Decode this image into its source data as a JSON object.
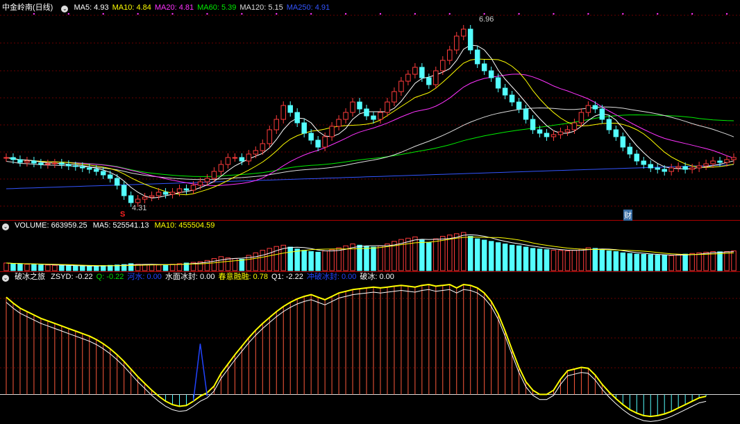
{
  "main": {
    "title": "中金岭南(日线)",
    "ma": [
      {
        "label": "MA5: 4.93",
        "color": "#ffffff"
      },
      {
        "label": "MA10: 4.84",
        "color": "#ffff00"
      },
      {
        "label": "MA20: 4.81",
        "color": "#ff33ff"
      },
      {
        "label": "MA60: 5.39",
        "color": "#00ee00"
      },
      {
        "label": "MA120: 5.15",
        "color": "#dddddd"
      },
      {
        "label": "MA250: 4.91",
        "color": "#3355ff"
      }
    ],
    "high_label": "6.96",
    "low_label": "4.31",
    "s_marker": "S",
    "cai_marker": "财"
  },
  "volume": {
    "label": "VOLUME: 663959.25",
    "ma5": "MA5: 525541.13",
    "ma10": "MA10: 455504.59"
  },
  "indicator": {
    "name": "破冰之旅",
    "items": [
      {
        "label": "ZSYD: -0.22",
        "color": "#ffffff"
      },
      {
        "label": "Q: -0.22",
        "color": "#00dd00"
      },
      {
        "label": "河水: 0.00",
        "color": "#2244ff"
      },
      {
        "label": "水面冰封: 0.00",
        "color": "#ffffff"
      },
      {
        "label": "春意融融: 0.78",
        "color": "#ffff00"
      },
      {
        "label": "Q1: -2.22",
        "color": "#ffffff"
      },
      {
        "label": "冲破冰封: 0.00",
        "color": "#2244ff"
      },
      {
        "label": "破冰: 0.00",
        "color": "#ffffff"
      }
    ]
  },
  "chart_data": [
    {
      "type": "candlestick",
      "title": "中金岭南(日线)",
      "ylim": [
        4.2,
        7.1
      ],
      "high": 6.96,
      "low": 4.31,
      "close": [
        5.05,
        5.02,
        4.98,
        5.0,
        4.97,
        4.95,
        4.96,
        4.97,
        4.95,
        4.93,
        4.92,
        4.9,
        4.88,
        4.85,
        4.8,
        4.75,
        4.65,
        4.5,
        4.4,
        4.45,
        4.48,
        4.5,
        4.55,
        4.52,
        4.55,
        4.6,
        4.58,
        4.65,
        4.7,
        4.75,
        4.85,
        4.95,
        5.05,
        5.05,
        5.0,
        5.1,
        5.15,
        5.25,
        5.45,
        5.6,
        5.8,
        5.7,
        5.55,
        5.4,
        5.3,
        5.2,
        5.35,
        5.5,
        5.6,
        5.7,
        5.85,
        5.75,
        5.65,
        5.6,
        5.7,
        5.85,
        6.0,
        6.15,
        6.25,
        6.35,
        6.2,
        6.1,
        6.3,
        6.45,
        6.6,
        6.8,
        6.9,
        6.6,
        6.4,
        6.3,
        6.2,
        6.05,
        5.95,
        5.85,
        5.75,
        5.6,
        5.45,
        5.4,
        5.35,
        5.38,
        5.42,
        5.45,
        5.55,
        5.7,
        5.8,
        5.75,
        5.6,
        5.45,
        5.35,
        5.2,
        5.1,
        5.0,
        4.95,
        4.9,
        4.88,
        4.85,
        4.9,
        4.92,
        4.88,
        4.9,
        4.93,
        4.96,
        5.0,
        4.98,
        5.02,
        5.05
      ]
    },
    {
      "type": "bar",
      "title": "VOLUME",
      "values": [
        60,
        55,
        52,
        50,
        48,
        45,
        44,
        42,
        40,
        38,
        37,
        35,
        36,
        38,
        40,
        42,
        45,
        48,
        55,
        50,
        48,
        46,
        45,
        47,
        50,
        55,
        60,
        65,
        70,
        80,
        95,
        110,
        100,
        95,
        90,
        120,
        140,
        160,
        175,
        190,
        200,
        185,
        170,
        160,
        150,
        145,
        155,
        165,
        180,
        195,
        210,
        200,
        190,
        185,
        195,
        210,
        230,
        245,
        255,
        265,
        240,
        220,
        250,
        270,
        280,
        290,
        300,
        270,
        250,
        240,
        230,
        220,
        210,
        200,
        195,
        185,
        175,
        170,
        165,
        160,
        158,
        155,
        160,
        170,
        180,
        175,
        165,
        155,
        150,
        140,
        135,
        130,
        128,
        125,
        122,
        120,
        118,
        125,
        130,
        135,
        140,
        145,
        150,
        148,
        150,
        155
      ]
    },
    {
      "type": "line",
      "title": "破冰之旅",
      "ylim": [
        -3,
        13
      ],
      "series": [
        {
          "name": "ZSYD",
          "values": [
            11.5,
            10.8,
            10.2,
            9.8,
            9.4,
            9.0,
            8.7,
            8.4,
            8.1,
            7.8,
            7.5,
            7.2,
            6.9,
            6.5,
            6.0,
            5.4,
            4.7,
            3.9,
            3.0,
            2.1,
            1.3,
            0.5,
            -0.2,
            -0.8,
            -1.2,
            -1.4,
            -1.3,
            -0.8,
            -0.2,
            0.2,
            1.0,
            2.5,
            3.6,
            4.7,
            5.7,
            6.7,
            7.6,
            8.4,
            9.1,
            9.8,
            10.4,
            10.9,
            11.3,
            11.6,
            11.8,
            11.5,
            11.2,
            11.6,
            12.0,
            12.2,
            12.4,
            12.5,
            12.6,
            12.7,
            12.6,
            12.7,
            12.8,
            12.9,
            12.8,
            12.7,
            12.9,
            13.0,
            12.8,
            12.9,
            13.0,
            12.6,
            13.0,
            12.9,
            12.6,
            12.0,
            11.0,
            9.5,
            7.5,
            5.3,
            3.2,
            1.5,
            0.5,
            0.0,
            0.0,
            0.5,
            1.8,
            2.8,
            3.0,
            3.2,
            3.1,
            2.3,
            1.2,
            0.3,
            -0.5,
            -1.2,
            -1.8,
            -2.2,
            -2.5,
            -2.6,
            -2.5,
            -2.3,
            -2.0,
            -1.6,
            -1.2,
            -0.8,
            -0.4,
            -0.22
          ]
        }
      ]
    }
  ]
}
